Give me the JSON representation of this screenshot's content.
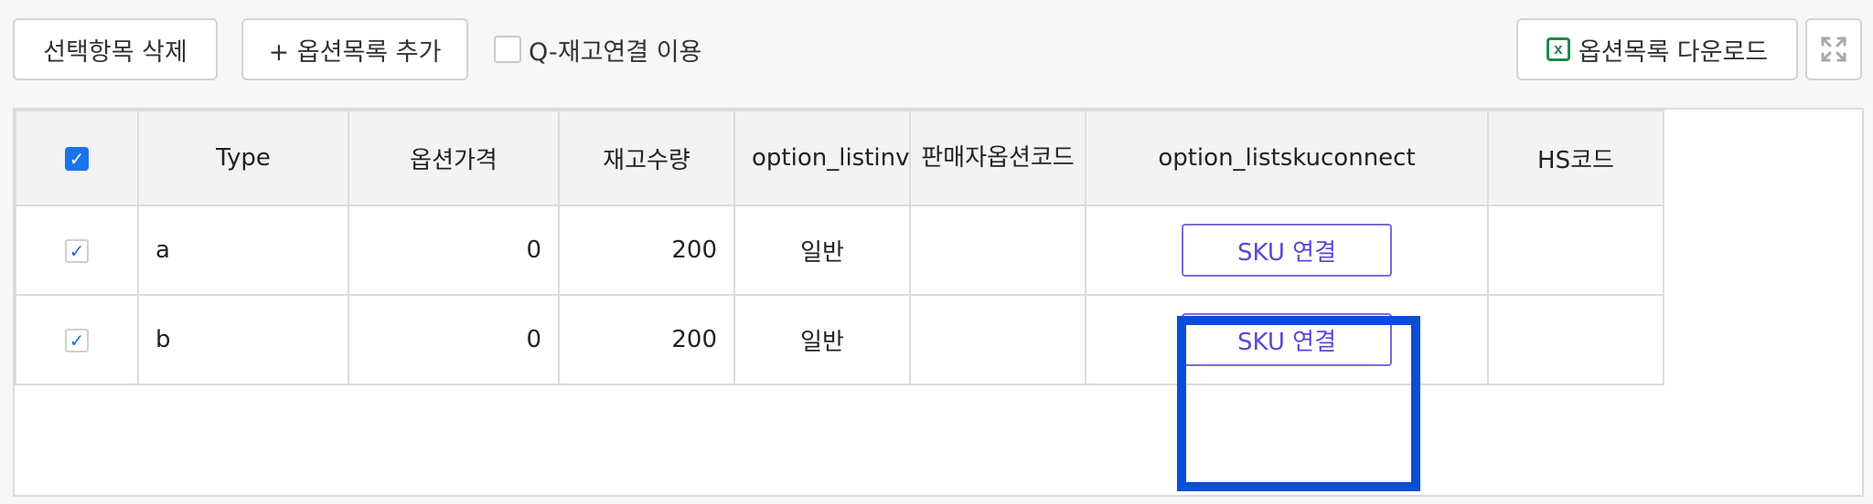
{
  "toolbar": {
    "delete_label": "선택항목 삭제",
    "add_label": "+ 옵션목록 추가",
    "qlink_label": "Q-재고연결 이용",
    "download_label": "옵션목록 다운로드",
    "download_icon_glyph": "x",
    "expand_icon": "expand-arrows-icon"
  },
  "grid": {
    "headers": {
      "type": "Type",
      "price": "옵션가격",
      "stock": "재고수량",
      "listinv": "option_listinv",
      "seller_code": "판매자옵션코드",
      "sku_connect": "option_listskuconnect",
      "hs_code": "HS코드"
    },
    "rows": [
      {
        "type": "a",
        "price": "0",
        "stock": "200",
        "listinv": "일반",
        "seller_code": "",
        "sku_button": "SKU 연결",
        "hs_code": ""
      },
      {
        "type": "b",
        "price": "0",
        "stock": "200",
        "listinv": "일반",
        "seller_code": "",
        "sku_button": "SKU 연결",
        "hs_code": ""
      }
    ]
  },
  "colors": {
    "accent": "#1a73e8",
    "sku_button_text": "#5b46d6",
    "highlight": "#0a4ed6",
    "excel_green": "#1e8a4c"
  }
}
